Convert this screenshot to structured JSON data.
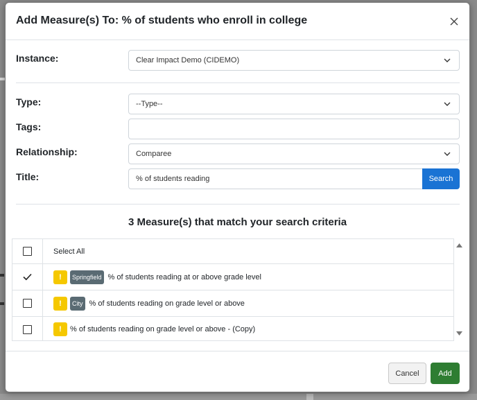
{
  "modal": {
    "title": "Add Measure(s) To: % of students who enroll in college"
  },
  "form": {
    "instance": {
      "label": "Instance:",
      "value": "Clear Impact Demo (CIDEMO)"
    },
    "type": {
      "label": "Type:",
      "value": "--Type--"
    },
    "tags": {
      "label": "Tags:",
      "value": ""
    },
    "relationship": {
      "label": "Relationship:",
      "value": "Comparee"
    },
    "title": {
      "label": "Title:",
      "value": "% of students reading"
    },
    "search_label": "Search"
  },
  "results": {
    "heading": "3 Measure(s) that match your search criteria",
    "select_all_label": "Select All",
    "rows": [
      {
        "checked": true,
        "warn": "!",
        "location": "Springfield",
        "name": "% of students reading at or above grade level"
      },
      {
        "checked": false,
        "warn": "!",
        "location": "City",
        "name": "% of students reading on grade level or above"
      },
      {
        "checked": false,
        "warn": "!",
        "location": "",
        "name": "% of students reading on grade level or above - (Copy)"
      }
    ]
  },
  "footer": {
    "cancel_label": "Cancel",
    "add_label": "Add"
  },
  "colors": {
    "primary": "#1a73d4",
    "success": "#2e7d32",
    "warning": "#f5c800",
    "badge": "#5a6b73"
  }
}
